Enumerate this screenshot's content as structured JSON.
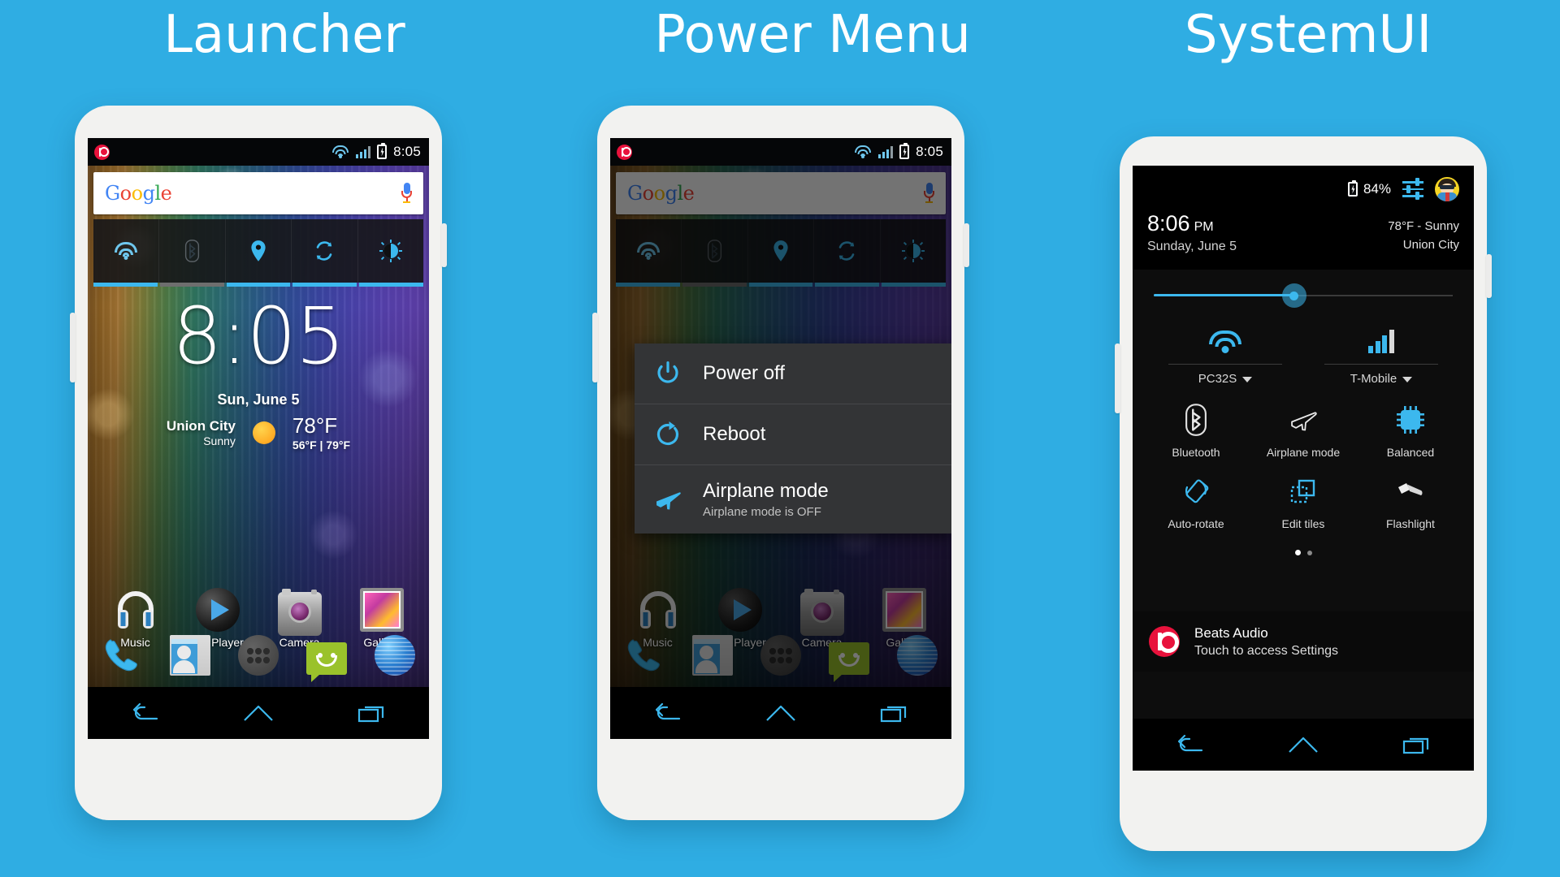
{
  "page": {
    "background_color": "#2fade3",
    "accent_blue": "#3cb8ee",
    "beats_red": "#e8123c"
  },
  "sections": [
    {
      "title": "Launcher"
    },
    {
      "title": "Power Menu"
    },
    {
      "title": "SystemUI"
    }
  ],
  "launcher": {
    "statusbar": {
      "beats_icon": "beats-logo-icon",
      "wifi_icon": "wifi-icon",
      "signal_icon": "cellular-signal-icon",
      "battery_icon": "battery-charging-icon",
      "time": "8:05"
    },
    "search": {
      "logo": "Google",
      "logo_letters": [
        "G",
        "o",
        "o",
        "g",
        "l",
        "e"
      ],
      "mic_icon": "microphone-icon"
    },
    "toggles": [
      {
        "name": "wifi",
        "icon": "wifi-icon",
        "on": true
      },
      {
        "name": "bluetooth",
        "icon": "bluetooth-icon",
        "on": false
      },
      {
        "name": "location",
        "icon": "location-pin-icon",
        "on": true
      },
      {
        "name": "sync",
        "icon": "sync-icon",
        "on": true
      },
      {
        "name": "brightness",
        "icon": "brightness-icon",
        "on": true
      }
    ],
    "clock_widget": {
      "time": "8:05",
      "date": "Sun, June 5",
      "city": "Union City",
      "condition": "Sunny",
      "temp": "78°F",
      "range": "56°F | 79°F",
      "weather_icon": "sun-icon"
    },
    "apps": [
      {
        "label": "Music",
        "icon": "headphones-icon"
      },
      {
        "label": "MX Player",
        "icon": "play-button-icon"
      },
      {
        "label": "Camera",
        "icon": "camera-icon"
      },
      {
        "label": "Gallery",
        "icon": "gallery-icon"
      }
    ],
    "dock": [
      {
        "label": "Phone",
        "icon": "phone-handset-icon"
      },
      {
        "label": "People",
        "icon": "contacts-icon"
      },
      {
        "label": "All Apps",
        "icon": "app-drawer-icon"
      },
      {
        "label": "Messaging",
        "icon": "messaging-icon"
      },
      {
        "label": "Browser",
        "icon": "browser-globe-icon"
      }
    ],
    "navbar": [
      {
        "label": "Back",
        "icon": "back-icon"
      },
      {
        "label": "Home",
        "icon": "home-icon"
      },
      {
        "label": "Recents",
        "icon": "recents-icon"
      }
    ]
  },
  "power_menu": {
    "statusbar": {
      "time": "8:05"
    },
    "items": [
      {
        "label": "Power off",
        "sublabel": "",
        "icon": "power-icon"
      },
      {
        "label": "Reboot",
        "sublabel": "",
        "icon": "reboot-icon"
      },
      {
        "label": "Airplane mode",
        "sublabel": "Airplane mode is OFF",
        "icon": "airplane-icon"
      }
    ]
  },
  "systemui": {
    "header": {
      "battery_icon": "battery-charging-icon",
      "battery_percent": "84%",
      "settings_icon": "quick-settings-icon",
      "avatar_icon": "user-avatar-icon",
      "time": "8:06",
      "ampm": "PM",
      "date": "Sunday, June 5",
      "weather": "78°F - Sunny",
      "location": "Union City"
    },
    "brightness": {
      "label": "Brightness",
      "value_percent": 47
    },
    "connectivity": [
      {
        "label": "PC32S",
        "icon": "wifi-icon",
        "caret": true
      },
      {
        "label": "T-Mobile",
        "icon": "cellular-signal-icon",
        "caret": true
      }
    ],
    "tiles": [
      {
        "label": "Bluetooth",
        "icon": "bluetooth-icon",
        "active": false
      },
      {
        "label": "Airplane mode",
        "icon": "airplane-icon",
        "active": false
      },
      {
        "label": "Balanced",
        "icon": "cpu-chip-icon",
        "active": true
      },
      {
        "label": "Auto-rotate",
        "icon": "auto-rotate-icon",
        "active": true
      },
      {
        "label": "Edit tiles",
        "icon": "edit-tiles-icon",
        "active": true
      },
      {
        "label": "Flashlight",
        "icon": "flashlight-icon",
        "active": false
      }
    ],
    "page_indicator": {
      "pages": 2,
      "current": 1
    },
    "notification": {
      "icon": "beats-logo-icon",
      "title": "Beats Audio",
      "subtitle": "Touch to access Settings"
    },
    "navbar": [
      {
        "label": "Back",
        "icon": "back-icon"
      },
      {
        "label": "Home",
        "icon": "home-icon"
      },
      {
        "label": "Recents",
        "icon": "recents-icon"
      }
    ]
  }
}
